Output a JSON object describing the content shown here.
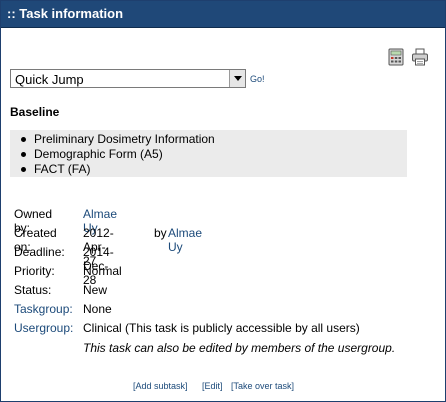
{
  "title": ":: Task information",
  "icons": {
    "calc": "calculator-icon",
    "print": "printer-icon"
  },
  "quick_jump": {
    "selected": "Quick Jump",
    "go_label": "Go!"
  },
  "baseline": {
    "heading": "Baseline",
    "items": [
      "Preliminary Dosimetry Information",
      "Demographic Form (A5)",
      "FACT (FA)"
    ]
  },
  "details": {
    "owned_by_label": "Owned by:",
    "owned_by": "Almae Uy",
    "created_label": "Created on:",
    "created_date": "2012-Apr-27",
    "created_by_word": "by",
    "created_by": "Almae Uy",
    "deadline_label": "Deadline:",
    "deadline": "2014-Dec-28",
    "priority_label": "Priority:",
    "priority": "Normal",
    "status_label": "Status:",
    "status": "New",
    "taskgroup_label": "Taskgroup:",
    "taskgroup": "None",
    "usergroup_label": "Usergroup:",
    "usergroup": "Clinical (This task is publicly accessible by all users)",
    "usergroup_note": "This task can also be edited by members of the usergroup."
  },
  "footer": {
    "add_subtask": "Add subtask",
    "edit": "Edit",
    "take_over": "Take over task"
  },
  "colors": {
    "titlebar": "#1f4878",
    "link": "#1c4a7a",
    "list_bg": "#ebebeb"
  }
}
